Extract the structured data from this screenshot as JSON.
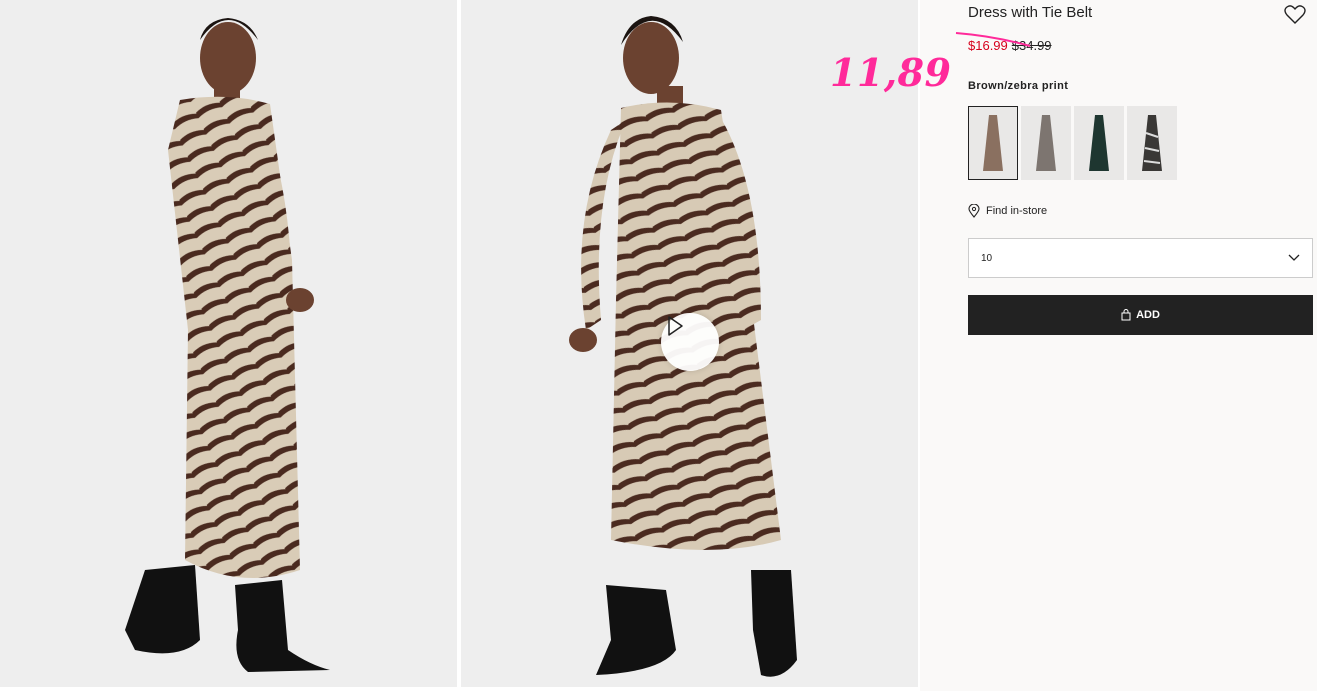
{
  "product": {
    "title": "Dress with Tie Belt",
    "sale_price": "$16.99",
    "original_price": "$34.99",
    "handwritten_price": "11,89",
    "color_name": "Brown/zebra print",
    "find_in_store": "Find in-store",
    "selected_size": "10",
    "add_label": "ADD"
  },
  "swatches": [
    {
      "name": "brown-zebra",
      "color": "#8a7060",
      "active": true
    },
    {
      "name": "taupe",
      "color": "#7d7570",
      "active": false
    },
    {
      "name": "dark-green",
      "color": "#1e3630",
      "active": false
    },
    {
      "name": "black-white-print",
      "color": "#3a3836",
      "active": false
    }
  ],
  "icons": [
    "heart-icon",
    "play-icon",
    "location-pin-icon",
    "chevron-down-icon",
    "bag-icon"
  ],
  "colors": {
    "sale": "#d6001c",
    "annotation": "#ff2a9a",
    "button": "#222222"
  }
}
